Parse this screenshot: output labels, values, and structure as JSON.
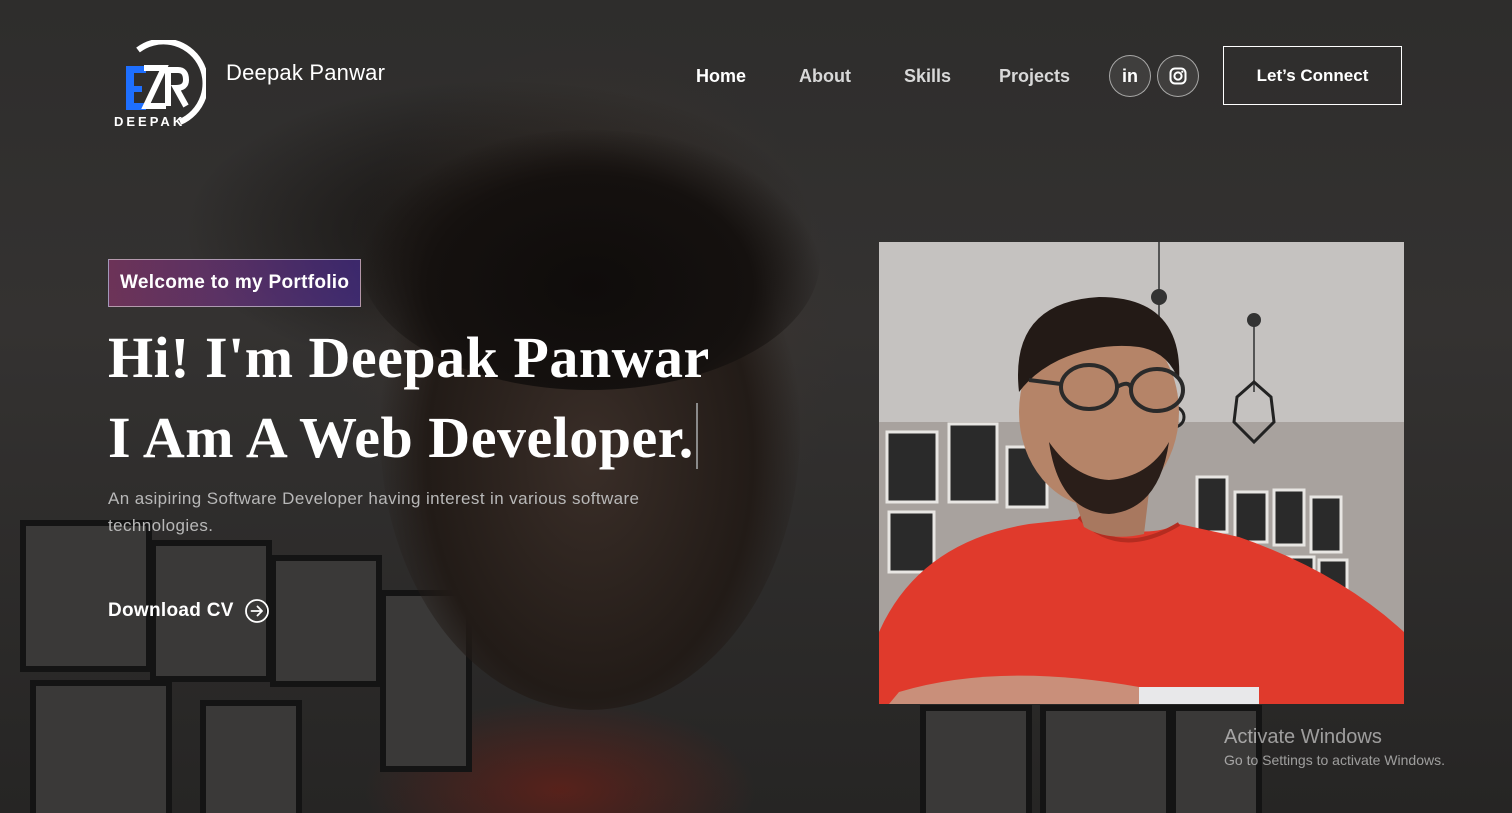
{
  "brand": {
    "logo_text": "DEEPAK",
    "logo_monogram": "EZR",
    "name": "Deepak Panwar"
  },
  "nav": {
    "items": [
      {
        "label": "Home",
        "active": true
      },
      {
        "label": "About",
        "active": false
      },
      {
        "label": "Skills",
        "active": false
      },
      {
        "label": "Projects",
        "active": false
      }
    ],
    "social": [
      {
        "icon": "linkedin-icon",
        "label": "in"
      },
      {
        "icon": "instagram-icon"
      }
    ],
    "connect_label": "Let’s Connect"
  },
  "hero": {
    "tagline": "Welcome to my Portfolio",
    "title_line1": "Hi! I'm Deepak Panwar",
    "title_line2": "I Am A Web Developer.",
    "description": "An asipiring Software Developer having interest in various software technologies.",
    "download_label": "Download CV",
    "download_icon": "arrow-right-circle-icon"
  },
  "portrait": {
    "image": "profile-photo",
    "shirt_color": "#e03a2c"
  },
  "watermark": {
    "title": "Activate Windows",
    "subtitle": "Go to Settings to activate Windows."
  },
  "colors": {
    "background": "#2b2a29",
    "accent_blue": "#1e6fff",
    "tagline_gradient_start": "#aa367c",
    "tagline_gradient_end": "#4a2fbd"
  }
}
